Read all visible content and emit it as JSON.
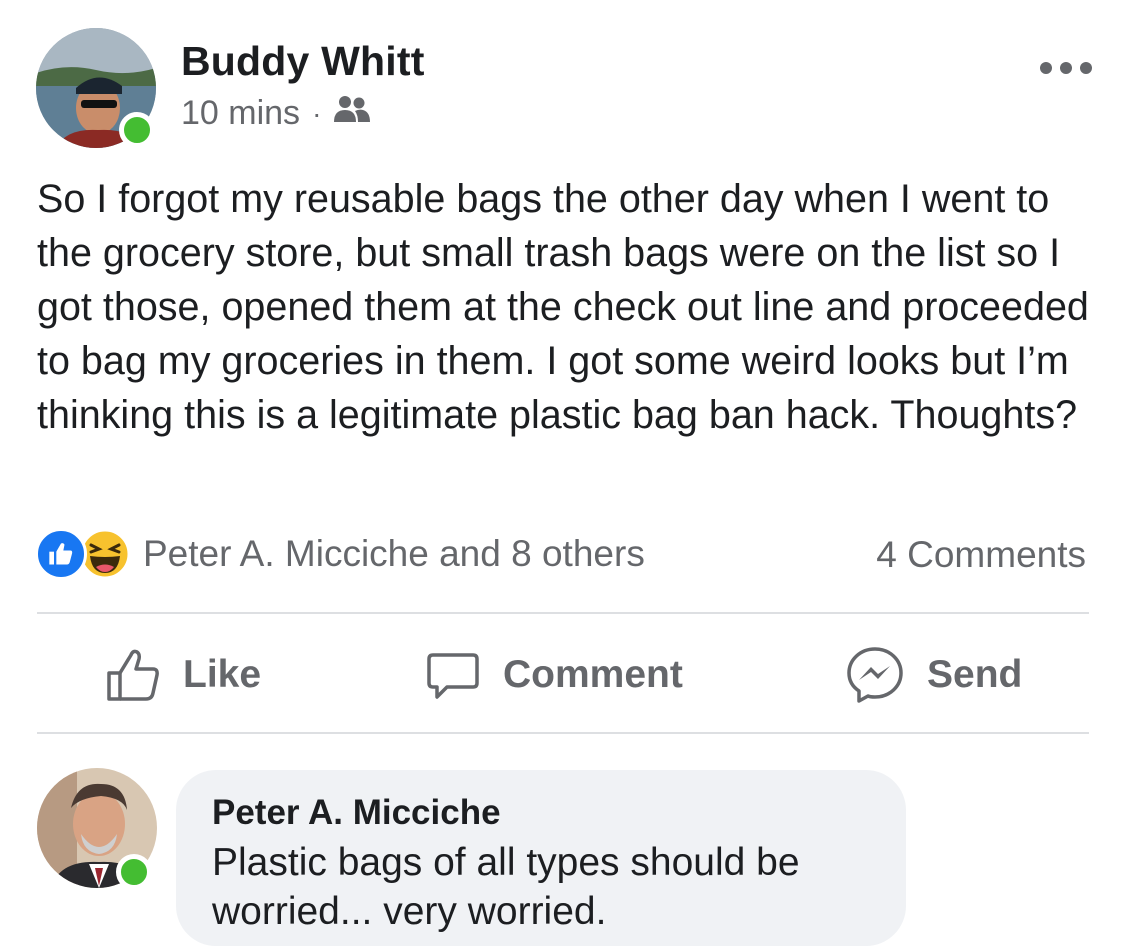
{
  "post": {
    "author": "Buddy Whitt",
    "time": "10 mins",
    "separator": "·",
    "audience_icon": "friends-icon",
    "more_icon": "more-options-icon",
    "text": "So I forgot my reusable bags the other day when I went to the grocery store, but small trash bags were on the list so I got those, opened them at the check out line and proceeded to bag my groceries in them. I got some weird looks but I’m thinking this is a legitimate plastic bag ban hack. Thoughts?"
  },
  "reactions": {
    "icons": [
      "like-reaction-icon",
      "haha-reaction-icon"
    ],
    "summary": "Peter A. Micciche and 8 others",
    "comments_count": "4 Comments"
  },
  "actions": {
    "like": "Like",
    "comment": "Comment",
    "send": "Send"
  },
  "comment": {
    "author": "Peter A. Micciche",
    "text": "Plastic bags of all types should be worried... very worried."
  },
  "colors": {
    "online": "#44bd32",
    "like_blue": "#1877f2",
    "secondary_text": "#65676b",
    "bubble": "#f0f2f5"
  }
}
